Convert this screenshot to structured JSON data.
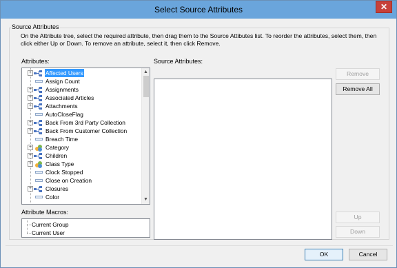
{
  "window": {
    "title": "Select Source Attributes",
    "close_label": "✕"
  },
  "group": {
    "label": "Source Attributes",
    "instructions": "On the Attribute tree, select the required attribute, then drag them to the Source Attibutes list. To reorder the attributes, select them, then click either Up or Down. To remove an attribute, select it, then click Remove."
  },
  "attributes_label": "Attributes:",
  "source_attributes_label": "Source Attributes:",
  "macros_label": "Attribute Macros:",
  "tree_items": [
    {
      "label": "Affected Users",
      "kind": "struct",
      "expandable": true,
      "selected": true
    },
    {
      "label": "Assign Count",
      "kind": "field",
      "expandable": false,
      "selected": false
    },
    {
      "label": "Assignments",
      "kind": "struct",
      "expandable": true,
      "selected": false
    },
    {
      "label": "Associated Articles",
      "kind": "struct",
      "expandable": true,
      "selected": false
    },
    {
      "label": "Attachments",
      "kind": "struct",
      "expandable": true,
      "selected": false
    },
    {
      "label": "AutoCloseFlag",
      "kind": "field",
      "expandable": false,
      "selected": false
    },
    {
      "label": "Back From 3rd Party Collection",
      "kind": "struct",
      "expandable": true,
      "selected": false
    },
    {
      "label": "Back From Customer Collection",
      "kind": "struct",
      "expandable": true,
      "selected": false
    },
    {
      "label": "Breach Time",
      "kind": "field",
      "expandable": false,
      "selected": false
    },
    {
      "label": "Category",
      "kind": "color",
      "expandable": true,
      "selected": false
    },
    {
      "label": "Children",
      "kind": "struct",
      "expandable": true,
      "selected": false
    },
    {
      "label": "Class Type",
      "kind": "color",
      "expandable": true,
      "selected": false
    },
    {
      "label": "Clock Stopped",
      "kind": "field",
      "expandable": false,
      "selected": false
    },
    {
      "label": "Close on Creation",
      "kind": "field",
      "expandable": false,
      "selected": false
    },
    {
      "label": "Closures",
      "kind": "struct",
      "expandable": true,
      "selected": false
    },
    {
      "label": "Color",
      "kind": "field",
      "expandable": false,
      "selected": false
    }
  ],
  "macro_items": [
    "Current Group",
    "Current User"
  ],
  "buttons": {
    "remove": "Remove",
    "remove_all": "Remove All",
    "up": "Up",
    "down": "Down",
    "ok": "OK",
    "cancel": "Cancel"
  },
  "colors": {
    "titlebar": "#6aa5dc",
    "selection": "#3399ff",
    "close": "#c7413a"
  }
}
